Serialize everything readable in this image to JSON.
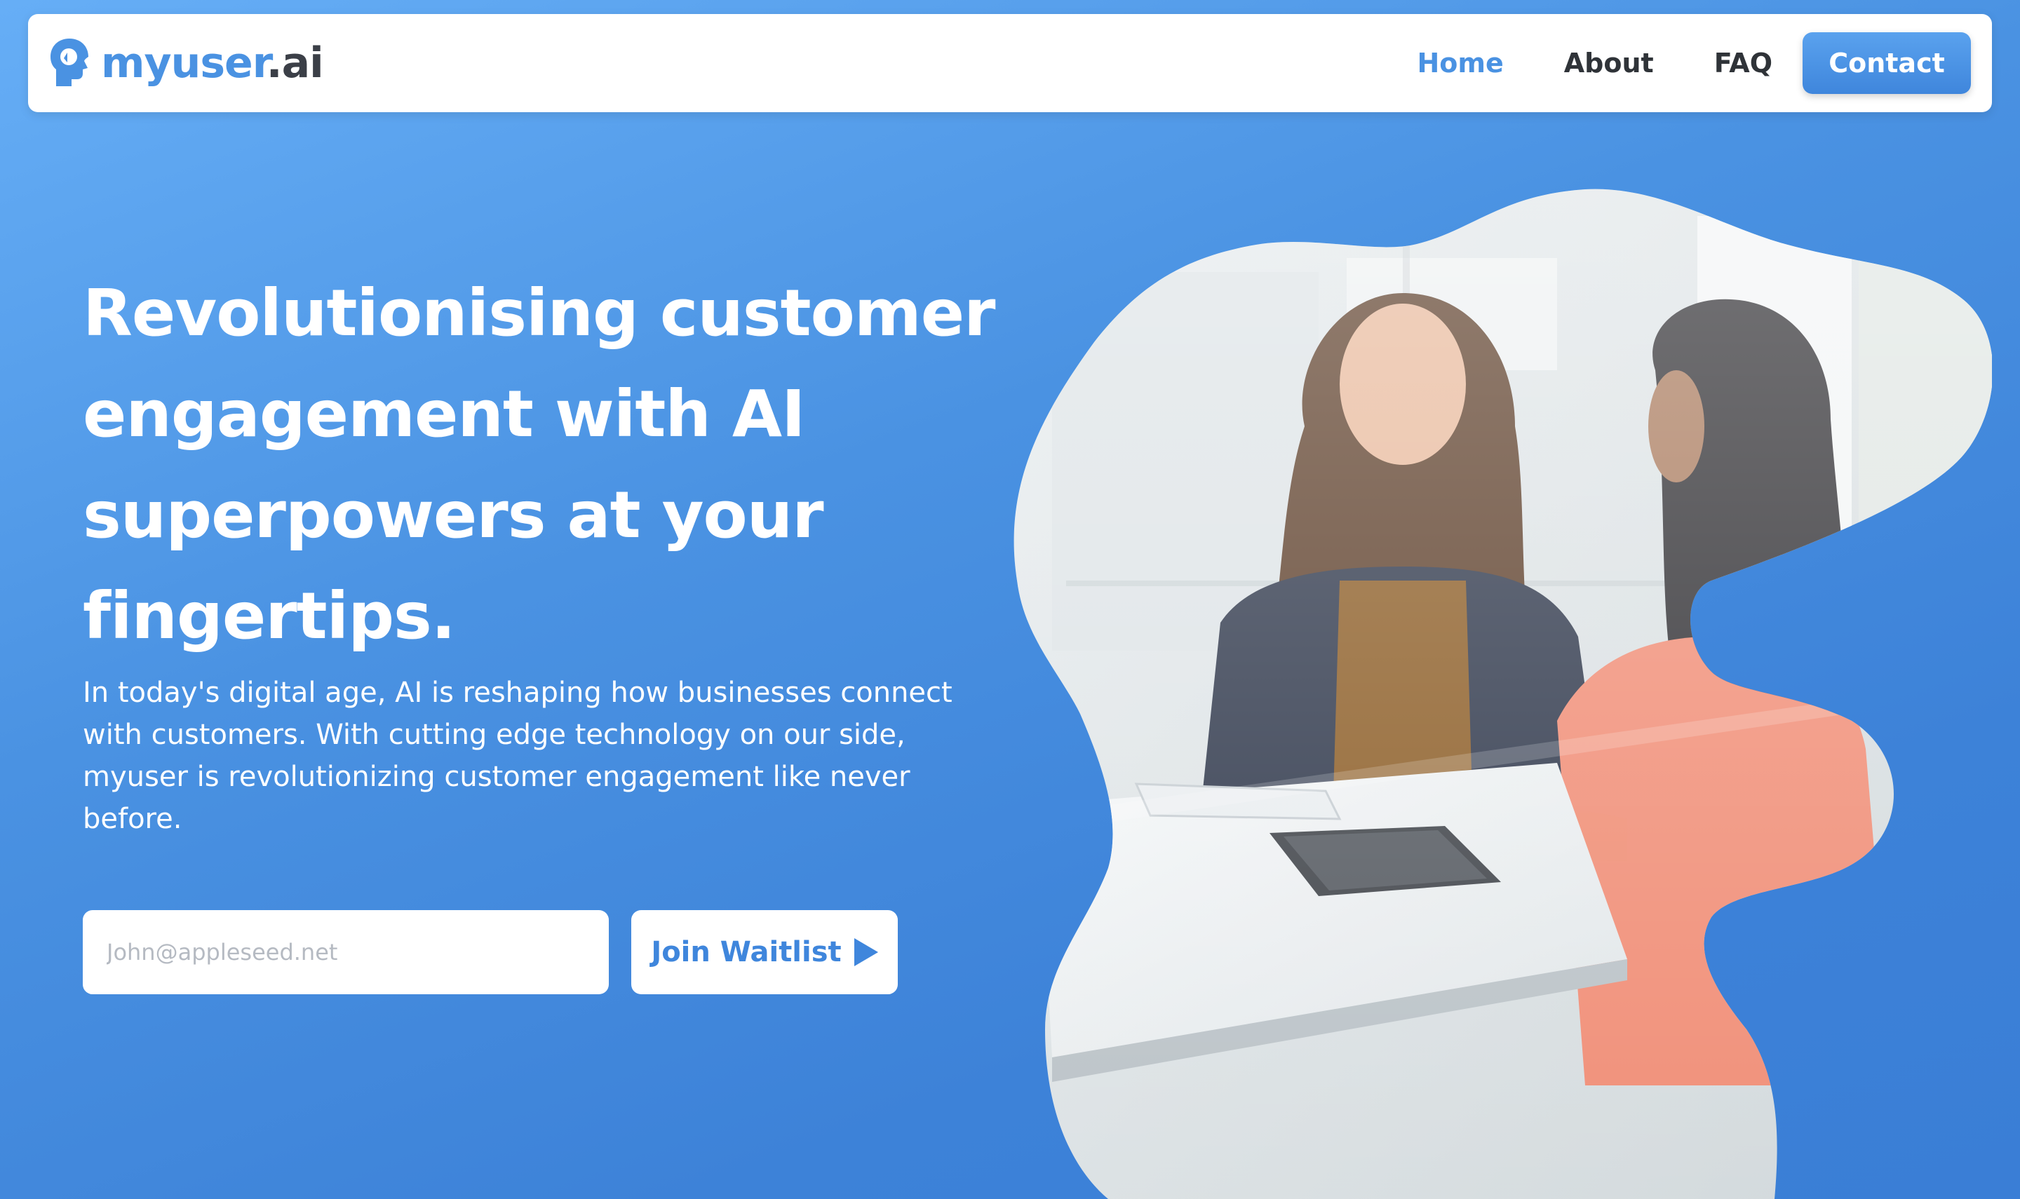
{
  "brand": {
    "name_main": "myuser",
    "name_tld": ".ai",
    "icon": "head-profile-icon",
    "color": "#4a92e2"
  },
  "nav": {
    "items": [
      {
        "label": "Home",
        "active": true
      },
      {
        "label": "About",
        "active": false
      },
      {
        "label": "FAQ",
        "active": false
      }
    ],
    "contact_label": "Contact"
  },
  "hero": {
    "title": "Revolutionising customer engagement with AI superpowers at your fingertips.",
    "subtitle": "In today's digital age, AI is reshaping how businesses connect with customers. With cutting edge technology on our side, myuser is revolutionizing customer engagement like never before.",
    "email_placeholder": "John@appleseed.net",
    "email_value": "",
    "cta_label": "Join Waitlist",
    "cta_icon": "play-triangle-icon",
    "image_icon": "photo-two-women-meeting"
  },
  "colors": {
    "accent": "#4a92e2",
    "background_top": "#66aef6",
    "background_bottom": "#3a7ed6",
    "text_dark": "#2f3338"
  }
}
